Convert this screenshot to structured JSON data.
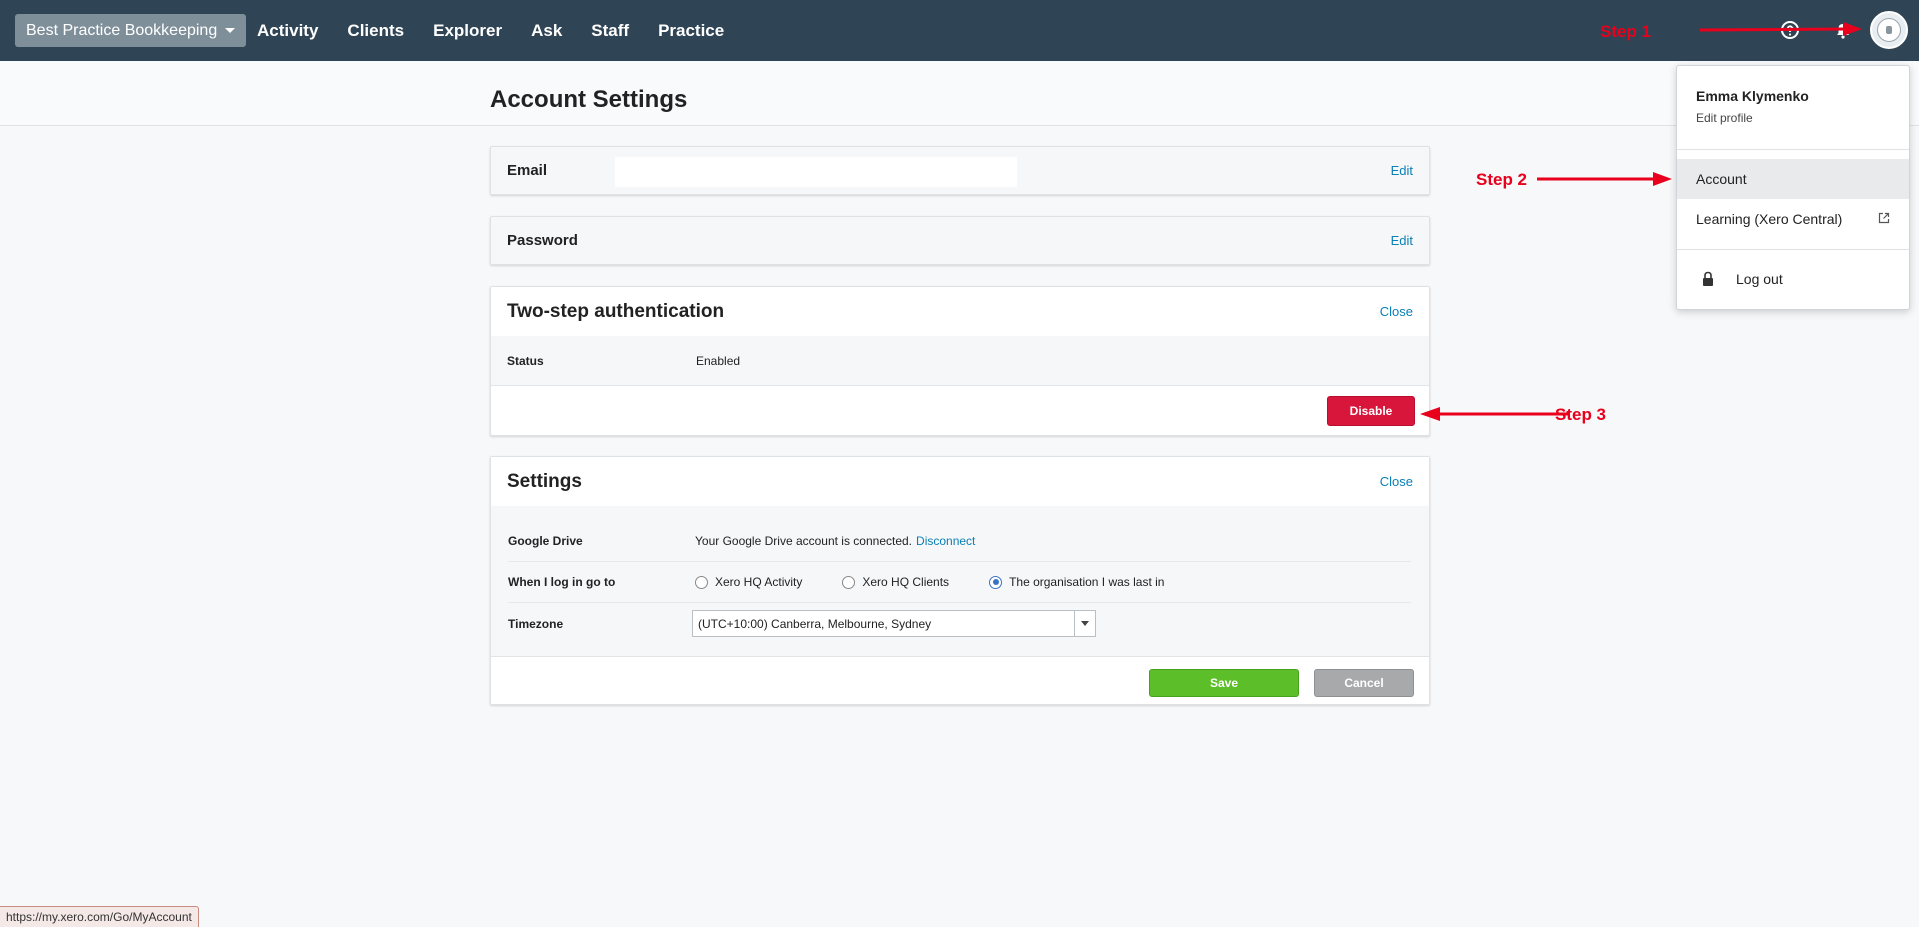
{
  "topbar": {
    "org_name": "Best Practice Bookkeeping",
    "nav": [
      "Activity",
      "Clients",
      "Explorer",
      "Ask",
      "Staff",
      "Practice"
    ]
  },
  "page": {
    "title": "Account Settings"
  },
  "email_card": {
    "label": "Email",
    "edit": "Edit"
  },
  "password_card": {
    "label": "Password",
    "edit": "Edit"
  },
  "two_step": {
    "heading": "Two-step authentication",
    "close": "Close",
    "status_label": "Status",
    "status_value": "Enabled",
    "disable_button": "Disable"
  },
  "settings": {
    "heading": "Settings",
    "close": "Close",
    "google_drive_label": "Google Drive",
    "google_drive_text": "Your Google Drive account is connected.",
    "disconnect": "Disconnect",
    "login_label": "When I log in go to",
    "login_options": [
      "Xero HQ Activity",
      "Xero HQ Clients",
      "The organisation I was last in"
    ],
    "login_selected_index": 2,
    "timezone_label": "Timezone",
    "timezone_value": "(UTC+10:00) Canberra, Melbourne, Sydney",
    "save": "Save",
    "cancel": "Cancel"
  },
  "user_menu": {
    "name": "Emma Klymenko",
    "edit_profile": "Edit profile",
    "items": [
      "Account",
      "Learning (Xero Central)"
    ],
    "logout": "Log out"
  },
  "annotations": {
    "step1": "Step 1",
    "step2": "Step 2",
    "step3": "Step 3"
  },
  "status_bar_url": "https://my.xero.com/Go/MyAccount",
  "colors": {
    "topbar": "#2f4454",
    "link": "#0a7fb6",
    "disable": "#d8153a",
    "save": "#5cbf2a",
    "annotation": "#e8001c"
  }
}
